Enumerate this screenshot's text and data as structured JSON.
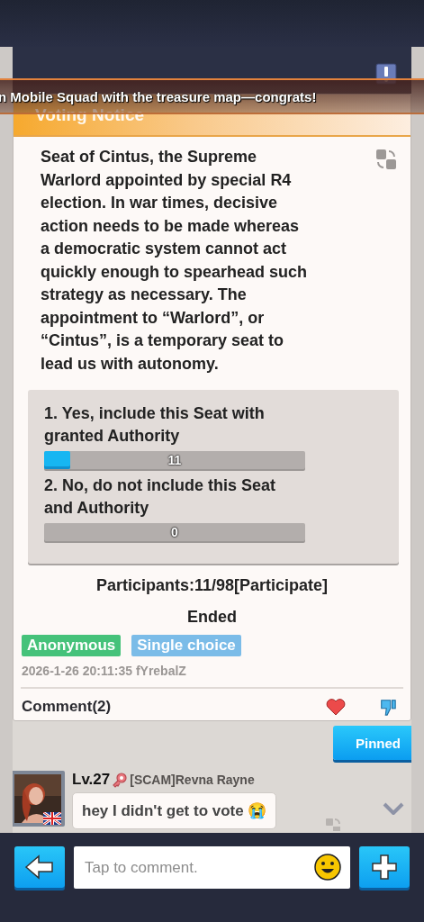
{
  "notice_banner": "n Mobile Squad with the treasure map—congrats!",
  "card": {
    "title": "Voting Notice",
    "body": "Seat of Cintus, the Supreme Warlord appointed by special R4 election. In war times, decisive action needs to be made whereas a democratic system cannot act quickly enough to spearhead such strategy as necessary. The appointment to “Warlord”, or “Cintus”, is a temporary seat to lead us with autonomy.",
    "options": [
      {
        "label": "1. Yes, include this Seat with granted Authority",
        "level": 0.1,
        "count": "11"
      },
      {
        "label": "2. No, do not include this Seat and Authority",
        "count": "0"
      }
    ],
    "participants": "Participants:11/98[Participate]",
    "status": "Ended",
    "tags": [
      {
        "label": "Anonymous",
        "color": "#45c27a"
      },
      {
        "label": "Single choice",
        "color": "#7bbce8"
      }
    ],
    "timestamp": "2026-1-26 20:11:35 fYrebalZ",
    "comments_label": "Comment(2)"
  },
  "pinned_button": "Pinned",
  "comment": {
    "level": "Lv.27",
    "author": "[SCAM]Revna Rayne",
    "text": "hey I didn't get to vote 😭"
  },
  "input": {
    "placeholder": "Tap to comment."
  }
}
